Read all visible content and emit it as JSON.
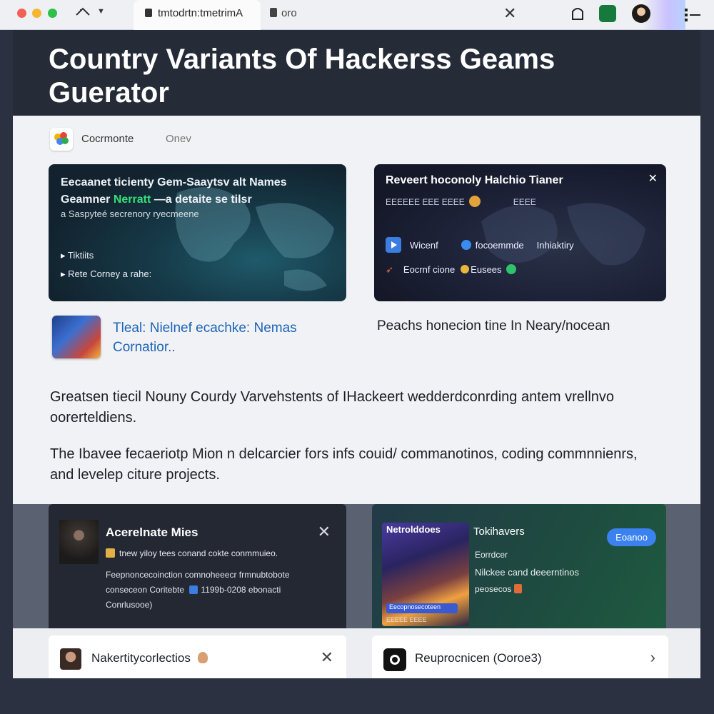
{
  "browser": {
    "active_tab": "tmtodrtn:tmetrimA",
    "second_tab": "oro",
    "close_glyph": "✕"
  },
  "hero": {
    "title": "Country Variants Of Hackerss Geams Guerator"
  },
  "breadcrumb": {
    "first": "Cocrmonte",
    "second": "Onev"
  },
  "card_world": {
    "title_pre": "Eecaanet ticienty Gem-Saaytsv alt Names Geamner ",
    "title_highlight": "Nerratt",
    "title_post": " —a detaite se tilsr",
    "subtitle": "a Saspyteé secrenory ryecmeene",
    "items": [
      "Tiktiits",
      "Rete Corney a rahe:"
    ]
  },
  "card_trainer": {
    "title": "Reveert hoconoly Halchio Tianer",
    "close": "✕",
    "meta_left": "EEEEEE EEE EEEE",
    "meta_right": "EEEE",
    "row1_label": "Wicenf",
    "row1_mid": "focoemmde",
    "row1_right": "Inhiaktiry",
    "row2_label": "Eocrnf cione",
    "row2_badge": "Eusees"
  },
  "article": {
    "link_title": "Tleal: Nielnef ecachke: Nemas Cornatior..",
    "right_title": "Peachs honecion tine In Neary/nocean",
    "para1": "Greatsen tiecil Nouny Courdy Varvehstents of IHackeert wedderdconrding antem vrellnvo oorerteldiens.",
    "para2": "The Ibavee fecaeriotp Mion n delcarcier fors infs couid/ commanotinos, coding commnnienrs, and levelep citure projects."
  },
  "card_notes": {
    "title": "Acerelnate Mies",
    "close": "✕",
    "subtitle": "tnew yiloy tees conand cokte conmmuieo.",
    "desc_pre": "Feepnoncecoinction comnoheeecr frmnubtobote conseceon Coritebte ",
    "desc_num": "1199b-0208 ebonacti",
    "desc_post": " Conrlusooe)"
  },
  "card_show": {
    "poster_title": "Netrolddoes",
    "poster_button": "Eecopnosecoteen",
    "poster_footer": "EEEEE EEEE",
    "title": "Tokihavers",
    "pill": "Eoanoo",
    "line1": "Eorrdcer",
    "line2": "Nilckee cand deeerntinos",
    "line3": "peosecos"
  },
  "card_collection": {
    "title": "Nakertitycorlectios",
    "close": "✕"
  },
  "card_repro": {
    "title": "Reuprocnicen (Ooroe3)",
    "chevron": "›"
  }
}
